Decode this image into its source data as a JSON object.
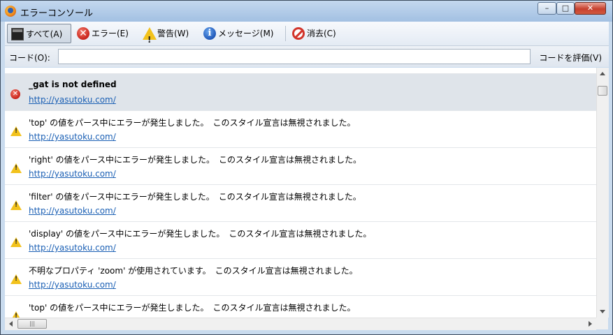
{
  "window": {
    "title": "エラーコンソール",
    "controls": {
      "minimize": "–",
      "maximize": "□",
      "close": "✕"
    }
  },
  "toolbar": {
    "all_label": "すべて(A)",
    "error_label": "エラー(E)",
    "warning_label": "警告(W)",
    "message_label": "メッセージ(M)",
    "clear_label": "消去(C)",
    "icons": {
      "all": "console-icon",
      "error": "error-icon",
      "warning": "warning-icon",
      "message": "info-icon",
      "clear": "no-entry-icon"
    }
  },
  "codebar": {
    "label": "コード(O):",
    "value": "",
    "eval_label": "コードを評価(V)"
  },
  "entries": [
    {
      "type": "error",
      "message": "_gat is not defined",
      "source": "http://yasutoku.com/"
    },
    {
      "type": "warning",
      "message": "'top' の値をパース中にエラーが発生しました。　このスタイル宣言は無視されました。",
      "source": "http://yasutoku.com/"
    },
    {
      "type": "warning",
      "message": "'right' の値をパース中にエラーが発生しました。　このスタイル宣言は無視されました。",
      "source": "http://yasutoku.com/"
    },
    {
      "type": "warning",
      "message": "'filter' の値をパース中にエラーが発生しました。　このスタイル宣言は無視されました。",
      "source": "http://yasutoku.com/"
    },
    {
      "type": "warning",
      "message": "'display' の値をパース中にエラーが発生しました。　このスタイル宣言は無視されました。",
      "source": "http://yasutoku.com/"
    },
    {
      "type": "warning",
      "message": "不明なプロパティ 'zoom' が使用されています。　このスタイル宣言は無視されました。",
      "source": "http://yasutoku.com/"
    },
    {
      "type": "warning",
      "message": "'top' の値をパース中にエラーが発生しました。　このスタイル宣言は無視されました。",
      "source": ""
    }
  ],
  "hscroll_thumb_glyph": "|||"
}
